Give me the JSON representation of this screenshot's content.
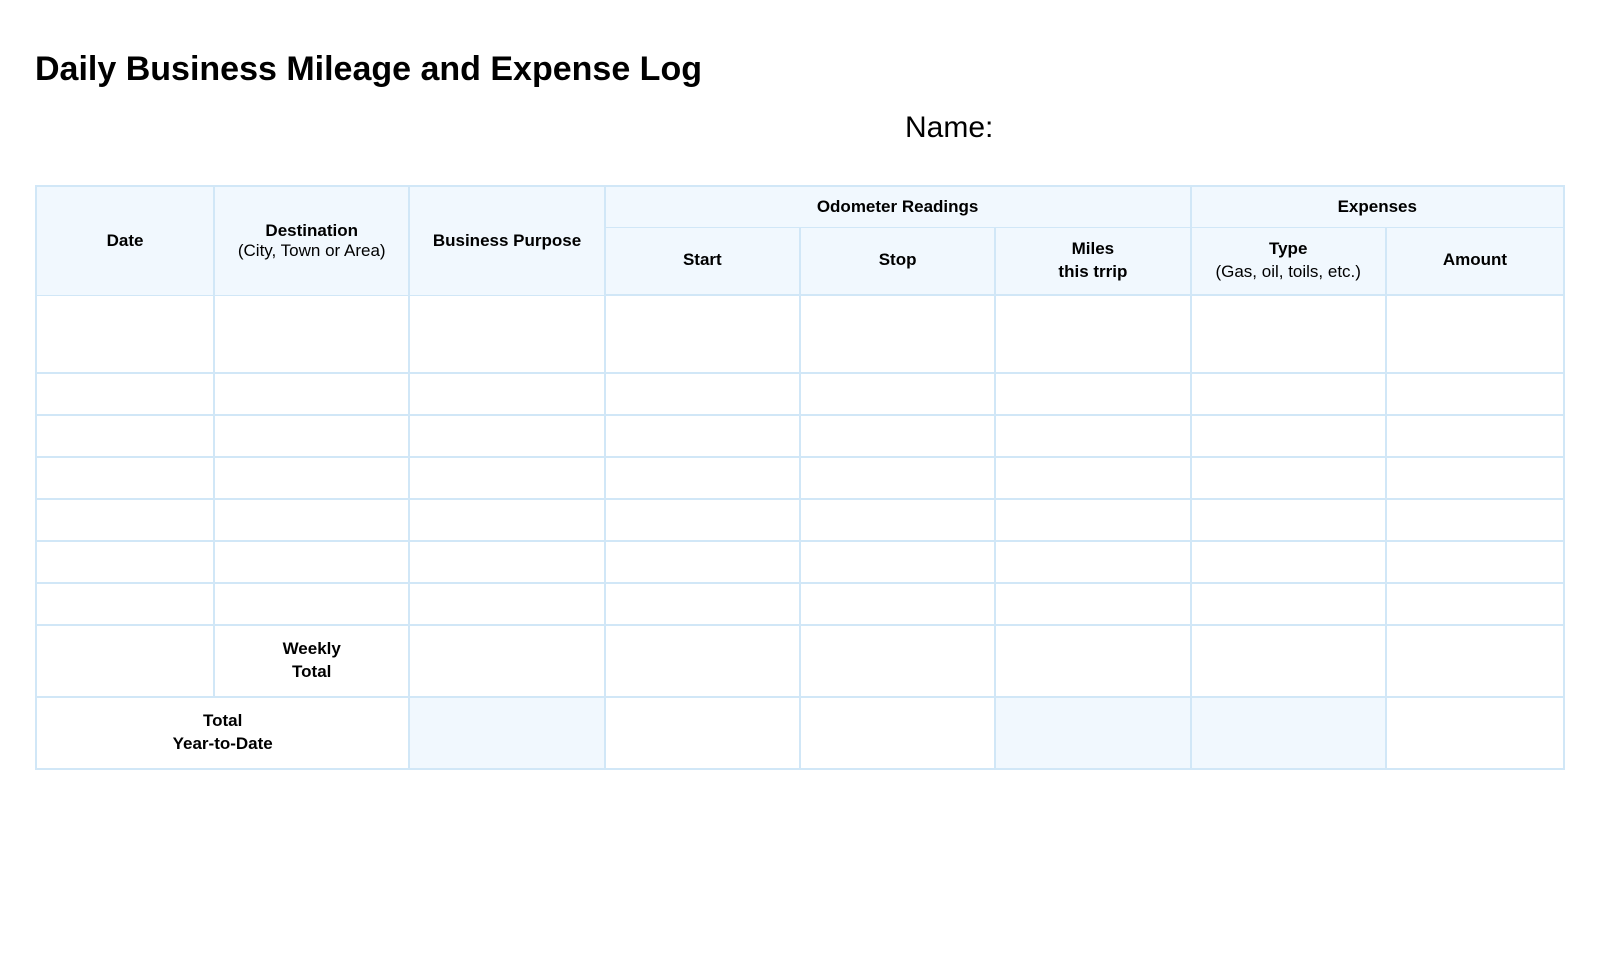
{
  "title": "Daily Business Mileage and Expense Log",
  "name_label": "Name:",
  "headers": {
    "odometer_group": "Odometer Readings",
    "expenses_group": "Expenses",
    "date": "Date",
    "destination": "Destination",
    "destination_sub": "(City, Town or Area)",
    "business_purpose": "Business Purpose",
    "start": "Start",
    "stop": "Stop",
    "miles_line1": "Miles",
    "miles_line2": "this trrip",
    "type": "Type",
    "type_sub": "(Gas, oil, toils, etc.)",
    "amount": "Amount"
  },
  "rows": [
    {
      "date": "",
      "destination": "",
      "purpose": "",
      "start": "",
      "stop": "",
      "miles": "",
      "type": "",
      "amount": ""
    },
    {
      "date": "",
      "destination": "",
      "purpose": "",
      "start": "",
      "stop": "",
      "miles": "",
      "type": "",
      "amount": ""
    },
    {
      "date": "",
      "destination": "",
      "purpose": "",
      "start": "",
      "stop": "",
      "miles": "",
      "type": "",
      "amount": ""
    },
    {
      "date": "",
      "destination": "",
      "purpose": "",
      "start": "",
      "stop": "",
      "miles": "",
      "type": "",
      "amount": ""
    },
    {
      "date": "",
      "destination": "",
      "purpose": "",
      "start": "",
      "stop": "",
      "miles": "",
      "type": "",
      "amount": ""
    },
    {
      "date": "",
      "destination": "",
      "purpose": "",
      "start": "",
      "stop": "",
      "miles": "",
      "type": "",
      "amount": ""
    },
    {
      "date": "",
      "destination": "",
      "purpose": "",
      "start": "",
      "stop": "",
      "miles": "",
      "type": "",
      "amount": ""
    }
  ],
  "totals": {
    "weekly_line1": "Weekly",
    "weekly_line2": "Total",
    "ytd_line1": "Total",
    "ytd_line2": "Year-to-Date",
    "weekly": {
      "purpose": "",
      "start": "",
      "stop": "",
      "miles": "",
      "type": "",
      "amount": ""
    },
    "ytd": {
      "purpose": "",
      "start": "",
      "stop": "",
      "miles": "",
      "type": "",
      "amount": ""
    }
  }
}
